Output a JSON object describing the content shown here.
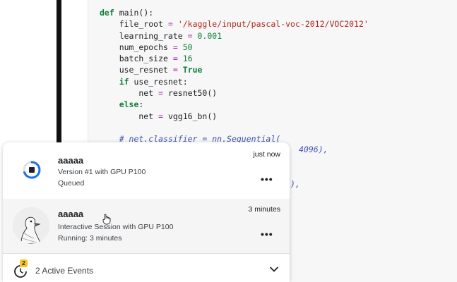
{
  "code": {
    "lines": [
      "def main():",
      "    file_root = '/kaggle/input/pascal-voc-2012/VOC2012'",
      "    learning_rate = 0.001",
      "    num_epochs = 50",
      "    batch_size = 16",
      "    use_resnet = True",
      "    if use_resnet:",
      "        net = resnet50()",
      "    else:",
      "        net = vgg16_bn()",
      "",
      "    # net.classifier = nn.Sequential("
    ],
    "ghost_fragments": [
      "4096),",
      "),"
    ]
  },
  "events": [
    {
      "title": "aaaaa",
      "line1": "Version #1 with GPU P100",
      "line2": "Queued",
      "time": "just now",
      "icon": "queued-spinner-icon"
    },
    {
      "title": "aaaaa",
      "line1": "Interactive Session with GPU P100",
      "line2": "Running: 3 minutes",
      "time": "3 minutes",
      "icon": "goose-avatar"
    }
  ],
  "more_label": "•••",
  "footer": {
    "label": "2 Active Events",
    "badge": "2",
    "icon": "clock-activity-icon",
    "toggle_icon": "chevron-down-icon"
  },
  "colors": {
    "accent": "#1a73e8",
    "badge": "#f5c518"
  }
}
